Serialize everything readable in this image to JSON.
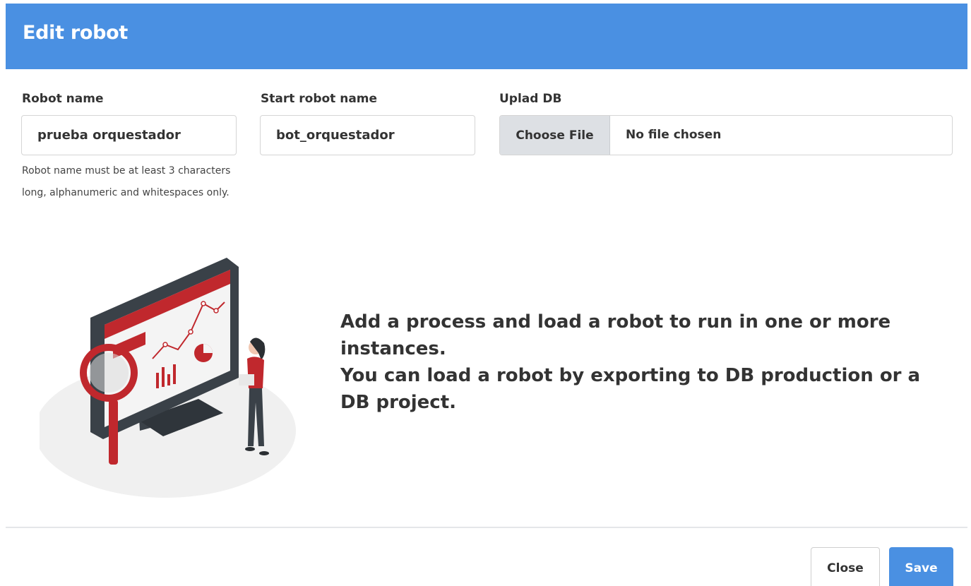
{
  "modal": {
    "title": "Edit robot"
  },
  "form": {
    "robot_name": {
      "label": "Robot name",
      "value": "prueba orquestador",
      "help": "Robot name must be at least 3 characters long, alphanumeric and whitespaces only."
    },
    "start_robot_name": {
      "label": "Start robot name",
      "value": "bot_orquestador"
    },
    "upload_db": {
      "label": "Uplad DB",
      "button_label": "Choose File",
      "status": "No file chosen"
    }
  },
  "info": {
    "line1": "Add a process and load a robot to run in one or more instances.",
    "line2": "You can load a robot by exporting to DB production or a DB project."
  },
  "footer": {
    "close_label": "Close",
    "save_label": "Save"
  },
  "colors": {
    "header": "#4a90e2",
    "primary_button": "#4a90e2",
    "illustration_accent": "#c0282d",
    "illustration_dark": "#3a4148"
  },
  "icons": {
    "illustration": "analytics-illustration"
  }
}
